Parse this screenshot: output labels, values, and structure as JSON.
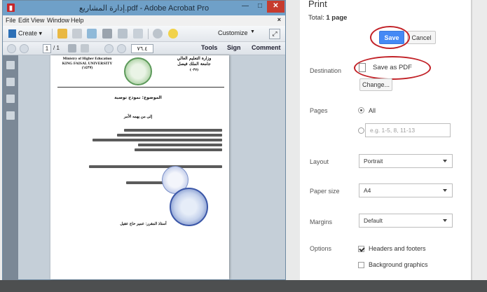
{
  "acrobat": {
    "title": "إدارة المشاريع.pdf - Adobe Acrobat Pro",
    "menu": [
      "File",
      "Edit",
      "View",
      "Window",
      "Help"
    ],
    "toolbar": {
      "create_label": "Create",
      "customize_label": "Customize"
    },
    "nav": {
      "current_page": "1",
      "page_of": "/ 1",
      "zoom": "٧٦.٤"
    },
    "tabs": {
      "tools": "Tools",
      "sign": "Sign",
      "comment": "Comment"
    }
  },
  "document": {
    "header_left": [
      "Ministry of Higher Education",
      "KING FAISAL UNIVERSITY",
      "(١٤٢٧)"
    ],
    "header_right": [
      "وزارة التعليم العالي",
      "جامعة الملك فيصل",
      "(٠٣٧)"
    ],
    "subject": "الموضوع: نموذج توصية",
    "to": "إلى من يهمه الأمر",
    "signer": "أستاذ المقرر: عمير حاج عقيل"
  },
  "print": {
    "title": "Print",
    "total_prefix": "Total:",
    "total_value": "1 page",
    "save_label": "Save",
    "cancel_label": "Cancel",
    "destination_label": "Destination",
    "destination_value": "Save as PDF",
    "change_label": "Change...",
    "pages_label": "Pages",
    "pages_all": "All",
    "pages_placeholder": "e.g. 1-5, 8, 11-13",
    "layout_label": "Layout",
    "layout_value": "Portrait",
    "paper_label": "Paper size",
    "paper_value": "A4",
    "margins_label": "Margins",
    "margins_value": "Default",
    "options_label": "Options",
    "opt_headers": "Headers and footers",
    "opt_background": "Background graphics"
  }
}
